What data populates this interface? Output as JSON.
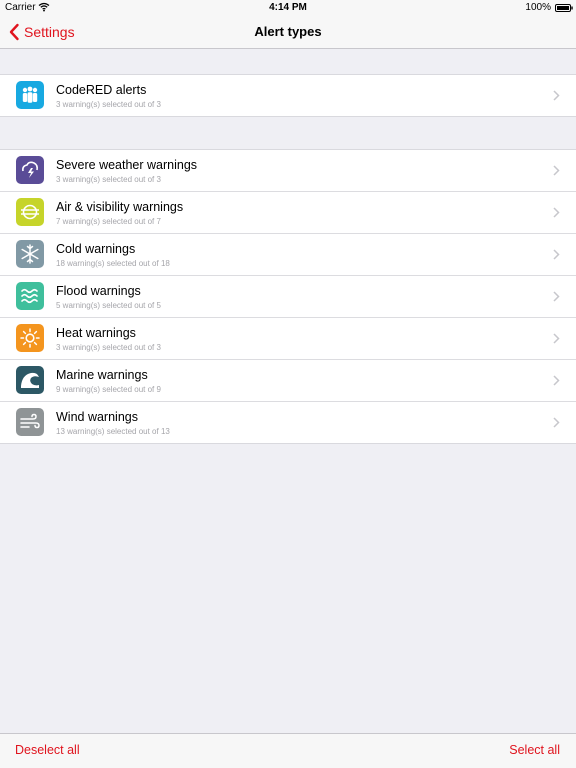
{
  "status": {
    "carrier": "Carrier",
    "time": "4:14 PM",
    "battery": "100%"
  },
  "nav": {
    "back_label": "Settings",
    "title": "Alert types"
  },
  "colors": {
    "accent": "#e0141e"
  },
  "sections": [
    {
      "rows": [
        {
          "icon": "people-icon",
          "color": "#18a9e1",
          "title": "CodeRED alerts",
          "subtitle": "3 warning(s) selected out of 3"
        }
      ]
    },
    {
      "rows": [
        {
          "icon": "storm-icon",
          "color": "#5a4c97",
          "title": "Severe weather warnings",
          "subtitle": "3 warning(s) selected out of 3"
        },
        {
          "icon": "air-quality-icon",
          "color": "#c6d42a",
          "title": "Air & visibility warnings",
          "subtitle": "7 warning(s) selected out of 7"
        },
        {
          "icon": "snowflake-icon",
          "color": "#8199a5",
          "title": "Cold warnings",
          "subtitle": "18 warning(s) selected out of 18"
        },
        {
          "icon": "flood-icon",
          "color": "#3fbf9c",
          "title": "Flood warnings",
          "subtitle": "5 warning(s) selected out of 5"
        },
        {
          "icon": "sun-icon",
          "color": "#f4951e",
          "title": "Heat warnings",
          "subtitle": "3 warning(s) selected out of 3"
        },
        {
          "icon": "wave-icon",
          "color": "#2c5865",
          "title": "Marine warnings",
          "subtitle": "9 warning(s) selected out of 9"
        },
        {
          "icon": "wind-icon",
          "color": "#8f9496",
          "title": "Wind warnings",
          "subtitle": "13 warning(s) selected out of 13"
        }
      ]
    }
  ],
  "toolbar": {
    "deselect_label": "Deselect all",
    "select_label": "Select all"
  }
}
